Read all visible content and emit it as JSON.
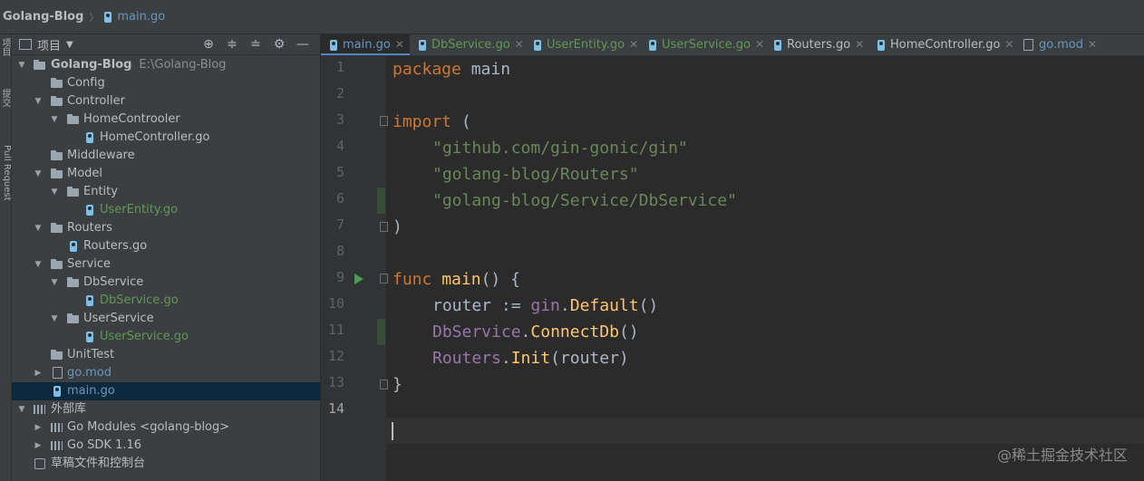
{
  "titlebar": {
    "project": "Golang-Blog",
    "separator": "〉",
    "file": "main.go"
  },
  "leftstrip": {
    "project_label": "项目",
    "commit_label": "提交",
    "pr_label": "Pull Request"
  },
  "project_panel": {
    "title": "项目",
    "tree": [
      {
        "label": "Golang-Blog",
        "suffix": "E:\\Golang-Blog"
      },
      {
        "label": "Config"
      },
      {
        "label": "Controller"
      },
      {
        "label": "HomeControoler"
      },
      {
        "label": "HomeController.go"
      },
      {
        "label": "Middleware"
      },
      {
        "label": "Model"
      },
      {
        "label": "Entity"
      },
      {
        "label": "UserEntity.go"
      },
      {
        "label": "Routers"
      },
      {
        "label": "Routers.go"
      },
      {
        "label": "Service"
      },
      {
        "label": "DbService"
      },
      {
        "label": "DbService.go"
      },
      {
        "label": "UserService"
      },
      {
        "label": "UserService.go"
      },
      {
        "label": "UnitTest"
      },
      {
        "label": "go.mod"
      },
      {
        "label": "main.go"
      },
      {
        "label": "外部库"
      },
      {
        "label": "Go Modules <golang-blog>"
      },
      {
        "label": "Go SDK 1.16"
      },
      {
        "label": "草稿文件和控制台"
      }
    ]
  },
  "tabs": [
    {
      "label": "main.go"
    },
    {
      "label": "DbService.go"
    },
    {
      "label": "UserEntity.go"
    },
    {
      "label": "UserService.go"
    },
    {
      "label": "Routers.go"
    },
    {
      "label": "HomeController.go"
    },
    {
      "label": "go.mod"
    }
  ],
  "editor": {
    "line_numbers": [
      "1",
      "2",
      "3",
      "4",
      "5",
      "6",
      "7",
      "8",
      "9",
      "10",
      "11",
      "12",
      "13",
      "14"
    ],
    "code": {
      "l1_kw": "package",
      "l1_name": " main",
      "l3_kw": "import",
      "l3_rest": " (",
      "l4": "\"github.com/gin-gonic/gin\"",
      "l5": "\"golang-blog/Routers\"",
      "l6": "\"golang-blog/Service/DbService\"",
      "l7": ")",
      "l9_kw": "func",
      "l9_fn": "main",
      "l9_rest": "() {",
      "l10_a": "router := ",
      "l10_pkg": "gin",
      "l10_dot": ".",
      "l10_fn": "Default",
      "l10_end": "()",
      "l11_pkg": "DbService",
      "l11_dot": ".",
      "l11_fn": "ConnectDb",
      "l11_end": "()",
      "l12_pkg": "Routers",
      "l12_dot": ".",
      "l12_fn": "Init",
      "l12_end": "(router)",
      "l13": "}"
    }
  },
  "watermark": "@稀土掘金技术社区",
  "colors": {
    "keyword": "#cc7832",
    "string": "#6a8759",
    "function": "#ffc66d",
    "selection": "#0d293e",
    "accent": "#4a88c7"
  }
}
